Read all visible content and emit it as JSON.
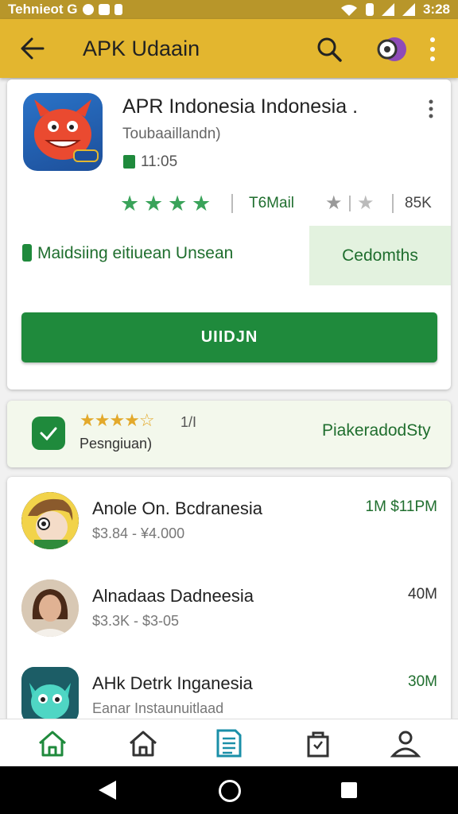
{
  "status_bar": {
    "carrier": "Tehnieot G",
    "time": "3:28"
  },
  "app_bar": {
    "title": "APK Udaain"
  },
  "app": {
    "name": "APR Indonesia Indonesia .",
    "developer": "Toubaaillandn)",
    "updated": "11:05",
    "stars_filled": 4,
    "rating_label": "T6Mail",
    "downloads": "85K",
    "maintenance_text": "Maidsiing eitiuean Unsean",
    "maintenance_action": "Cedomths",
    "install_label": "UIIDJN"
  },
  "rating_card": {
    "stars": "★★★★☆",
    "count": "1/I",
    "subtitle": "Pesngiuan)",
    "action": "PiakeradodSty"
  },
  "list": [
    {
      "title": "Anole On. Bcdranesia",
      "subtitle": "$3.84 - ¥4.000",
      "meta": "1M $11PM"
    },
    {
      "title": "Alnadaas Dadneesia",
      "subtitle": "$3.3K - $3-05",
      "meta": "40M"
    },
    {
      "title": "AHk Detrk Inganesia",
      "subtitle": "Eanar Instaunuitlaad",
      "meta": "30M"
    }
  ],
  "colors": {
    "accent": "#e3b62f",
    "primary_green": "#1f8a3c",
    "star_gold": "#e3a92b"
  }
}
